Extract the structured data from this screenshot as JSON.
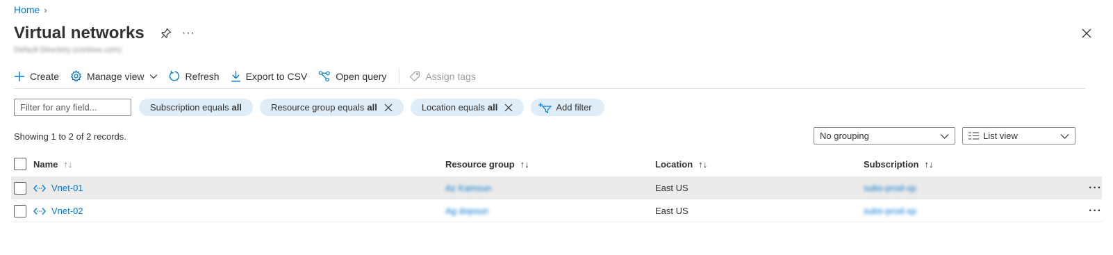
{
  "breadcrumb": {
    "home": "Home",
    "separator": "›"
  },
  "header": {
    "title": "Virtual networks",
    "subtitle": "Default Directory (contoso.com)",
    "more": "···"
  },
  "toolbar": {
    "create": "Create",
    "manage_view": "Manage view",
    "refresh": "Refresh",
    "export_csv": "Export to CSV",
    "open_query": "Open query",
    "assign_tags": "Assign tags"
  },
  "filters": {
    "placeholder": "Filter for any field...",
    "pills": [
      {
        "label": "Subscription equals",
        "value": "all"
      },
      {
        "label": "Resource group equals",
        "value": "all"
      },
      {
        "label": "Location equals",
        "value": "all"
      }
    ],
    "add_filter": "Add filter"
  },
  "records_text": "Showing 1 to 2 of 2 records.",
  "grouping": {
    "selected": "No grouping"
  },
  "view": {
    "selected": "List view"
  },
  "table": {
    "columns": {
      "name": "Name",
      "resource_group": "Resource group",
      "location": "Location",
      "subscription": "Subscription",
      "sort_glyph": "↑↓"
    },
    "rows": [
      {
        "name": "Vnet-01",
        "resource_group": "Az Kamsun",
        "location": "East US",
        "subscription": "subs-prod-xp",
        "more": "···"
      },
      {
        "name": "Vnet-02",
        "resource_group": "Ag dopsun",
        "location": "East US",
        "subscription": "subs-prod-xp",
        "more": "···"
      }
    ]
  },
  "colors": {
    "accent": "#0078d4",
    "pill_bg": "#dfedf9",
    "row_hover": "#edebe9"
  }
}
